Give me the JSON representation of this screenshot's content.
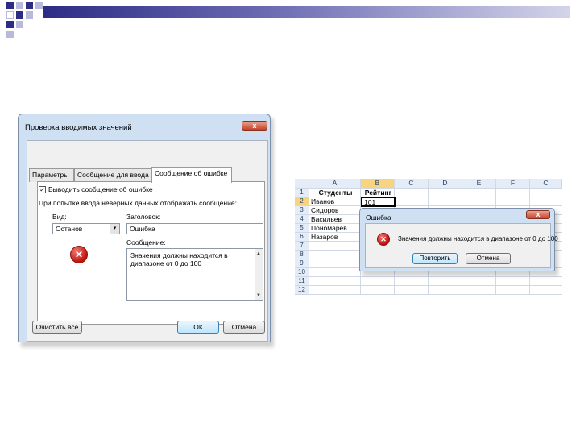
{
  "dialog_validation": {
    "title": "Проверка вводимых значений",
    "close_label": "x",
    "tabs": [
      {
        "label": "Параметры"
      },
      {
        "label": "Сообщение для ввода"
      },
      {
        "label": "Сообщение об ошибке"
      }
    ],
    "active_tab": 2,
    "show_error_label": "Выводить сообщение об ошибке",
    "show_error_checked": "✓",
    "invalid_input_text": "При попытке ввода неверных данных отображать сообщение:",
    "style_label": "Вид:",
    "style_value": "Останов",
    "style_dropdown_arrow": "▾",
    "title_label": "Заголовок:",
    "title_value": "Ошибка",
    "message_label": "Сообщение:",
    "message_value": "Значения должны находится в диапазоне от 0 до 100",
    "clear_all_button": "Очистить все",
    "ok_button": "ОК",
    "cancel_button": "Отмена",
    "error_icon_glyph": "✕"
  },
  "spreadsheet": {
    "columns": [
      "A",
      "B",
      "C",
      "D",
      "E",
      "F",
      "C"
    ],
    "selected_column": "B",
    "rows": [
      "1",
      "2",
      "3",
      "4",
      "5",
      "6",
      "7",
      "8",
      "9",
      "10",
      "11",
      "12"
    ],
    "selected_row": "2",
    "headers": {
      "a1": "Студенты",
      "b1": "Рейтинг"
    },
    "students": [
      "Иванов",
      "Сидоров",
      "Васильев",
      "Пономарев",
      "Назаров"
    ],
    "active_cell_value": "101"
  },
  "dialog_error": {
    "title": "Ошибка",
    "close_label": "x",
    "message": "Значения должны находится в диапазоне от 0 до 100",
    "retry_button": "Повторить",
    "cancel_button": "Отмена",
    "error_icon_glyph": "✕"
  },
  "colors": {
    "accent_dark": "#2c2c85",
    "accent_light": "#b9b9dc",
    "error_red": "#c1120e",
    "dialog_frame": "#cfe0f3"
  }
}
